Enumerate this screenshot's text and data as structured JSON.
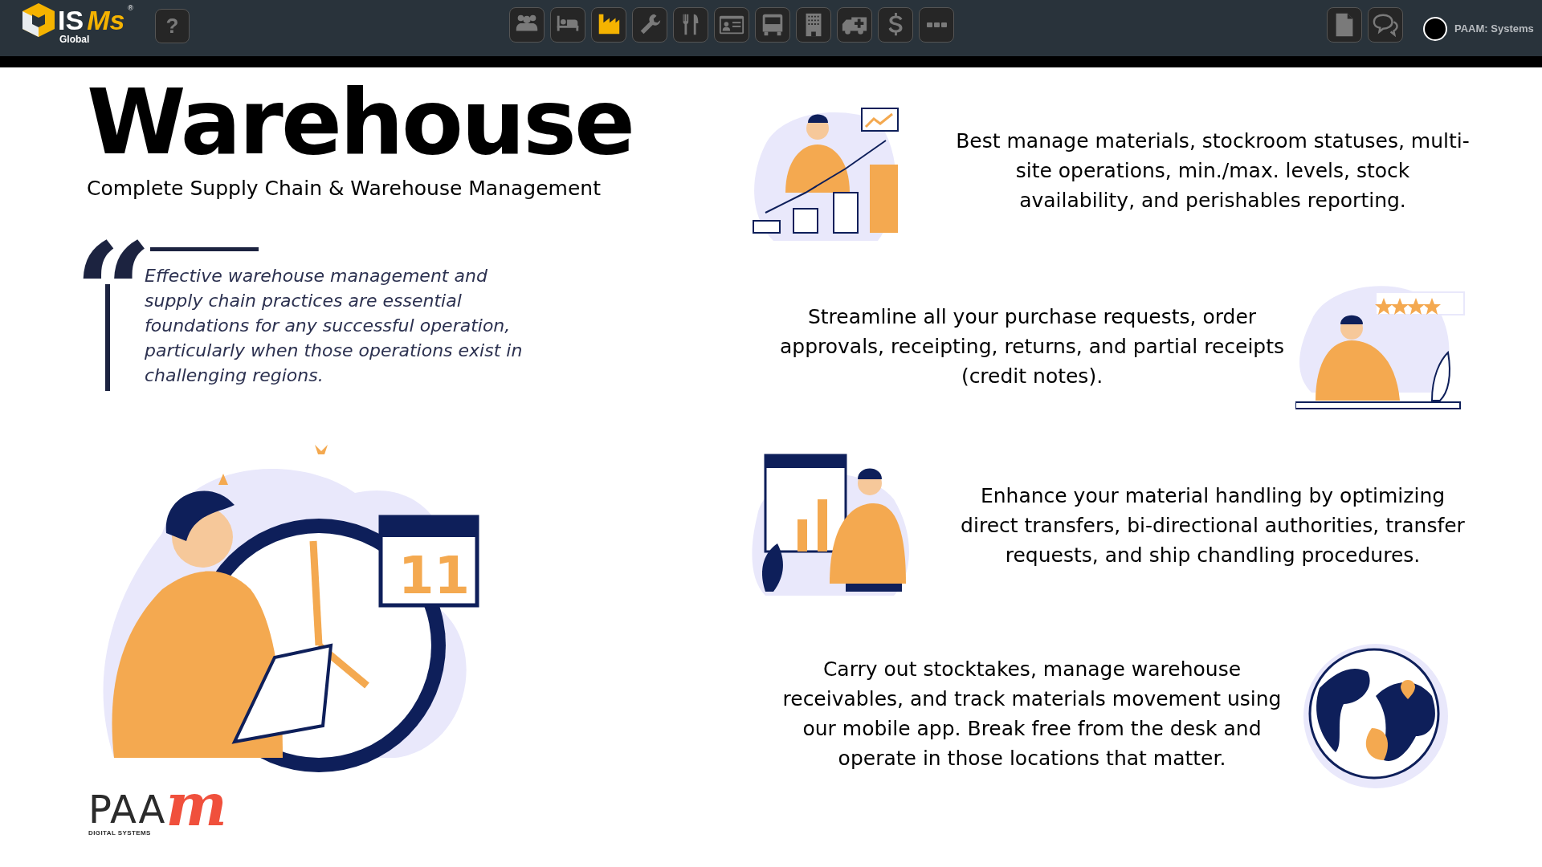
{
  "header": {
    "logo": {
      "main": "IS",
      "accent": "Ms",
      "registered": "®",
      "subtitle": "Global"
    },
    "help_button": "?",
    "modules": [
      {
        "kind": "people",
        "selected": false
      },
      {
        "kind": "bed",
        "selected": false
      },
      {
        "kind": "factory",
        "selected": true
      },
      {
        "kind": "wrench",
        "selected": false
      },
      {
        "kind": "cutlery",
        "selected": false
      },
      {
        "kind": "id-card",
        "selected": false
      },
      {
        "kind": "bus",
        "selected": false
      },
      {
        "kind": "building",
        "selected": false
      },
      {
        "kind": "ambulance",
        "selected": false
      },
      {
        "kind": "dollar",
        "selected": false
      },
      {
        "kind": "more",
        "selected": false
      }
    ],
    "tools": [
      {
        "kind": "document"
      },
      {
        "kind": "chat"
      }
    ],
    "user": "PAAM: Systems"
  },
  "title": "Warehouse",
  "subtitle": "Complete Supply Chain & Warehouse Management",
  "quote": {
    "mark": "“",
    "text": "Effective warehouse management and supply chain practices are essential foundations for any successful operation, particularly when those operations exist in challenging regions."
  },
  "illustration": {
    "calendar_day": "11"
  },
  "features": [
    {
      "kind": "chart-person",
      "text": "Best manage materials, stockroom statuses, multi-site operations, min./max. levels, stock availability, and perishables reporting."
    },
    {
      "kind": "reviewer",
      "text": "Streamline all your purchase requests, order approvals, receipting, returns, and partial receipts (credit notes)."
    },
    {
      "kind": "dashboard-person",
      "text": "Enhance your material handling by optimizing direct transfers, bi-directional authorities, transfer requests, and ship chandling procedures."
    },
    {
      "kind": "globe",
      "text": "Carry out stocktakes, manage warehouse receivables, and track materials movement using our mobile app. Break free from the desk and operate in those locations that matter."
    }
  ],
  "footer_logo": {
    "main": "PAA",
    "accent": "m",
    "tagline": "DIGITAL SYSTEMS"
  }
}
